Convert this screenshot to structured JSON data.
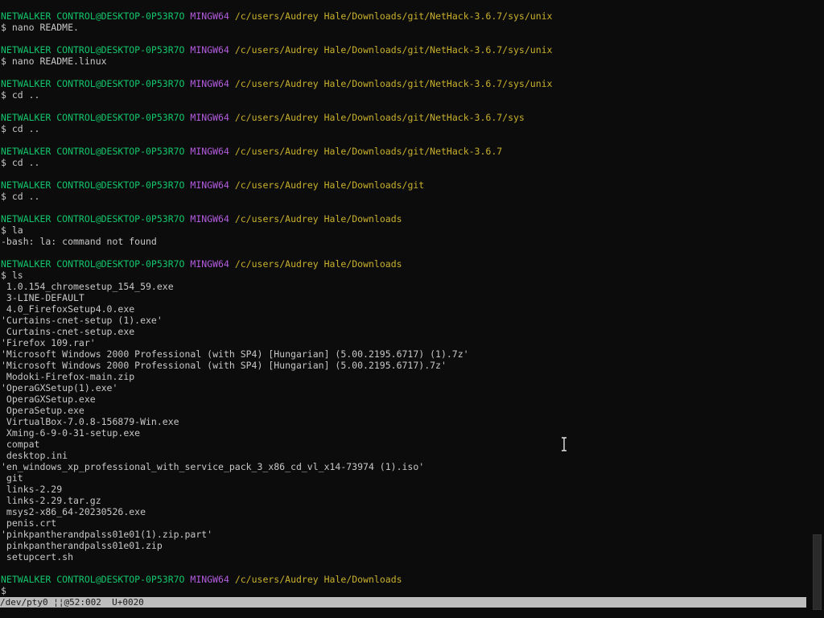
{
  "terminal": {
    "prompt_user": "NETWALKER CONTROL@DESKTOP-0P53R7O",
    "prompt_system": "MINGW64",
    "blocks": [
      {
        "path": "/c/users/Audrey Hale/Downloads/git/NetHack-3.6.7/sys/unix",
        "lines": [
          "$ nano README."
        ]
      },
      {
        "path": "/c/users/Audrey Hale/Downloads/git/NetHack-3.6.7/sys/unix",
        "lines": [
          "$ nano README.linux"
        ]
      },
      {
        "path": "/c/users/Audrey Hale/Downloads/git/NetHack-3.6.7/sys/unix",
        "lines": [
          "$ cd .."
        ]
      },
      {
        "path": "/c/users/Audrey Hale/Downloads/git/NetHack-3.6.7/sys",
        "lines": [
          "$ cd .."
        ]
      },
      {
        "path": "/c/users/Audrey Hale/Downloads/git/NetHack-3.6.7",
        "lines": [
          "$ cd .."
        ]
      },
      {
        "path": "/c/users/Audrey Hale/Downloads/git",
        "lines": [
          "$ cd .."
        ]
      },
      {
        "path": "/c/users/Audrey Hale/Downloads",
        "lines": [
          "$ la",
          "-bash: la: command not found"
        ]
      },
      {
        "path": "/c/users/Audrey Hale/Downloads",
        "lines": [
          "$ ls",
          " 1.0.154_chromesetup_154_59.exe",
          " 3-LINE-DEFAULT",
          " 4.0_FirefoxSetup4.0.exe",
          "'Curtains-cnet-setup (1).exe'",
          " Curtains-cnet-setup.exe",
          "'Firefox 109.rar'",
          "'Microsoft Windows 2000 Professional (with SP4) [Hungarian] (5.00.2195.6717) (1).7z'",
          "'Microsoft Windows 2000 Professional (with SP4) [Hungarian] (5.00.2195.6717).7z'",
          " Modoki-Firefox-main.zip",
          "'OperaGXSetup(1).exe'",
          " OperaGXSetup.exe",
          " OperaSetup.exe",
          " VirtualBox-7.0.8-156879-Win.exe",
          " Xming-6-9-0-31-setup.exe",
          " compat",
          " desktop.ini",
          "'en_windows_xp_professional_with_service_pack_3_x86_cd_vl_x14-73974 (1).iso'",
          " git",
          " links-2.29",
          " links-2.29.tar.gz",
          " msys2-x86_64-20230526.exe",
          " penis.crt",
          "'pinkpantherandpalss01e01(1).zip.part'",
          " pinkpantherandpalss01e01.zip",
          " setupcert.sh"
        ]
      },
      {
        "path": "/c/users/Audrey Hale/Downloads",
        "lines": [
          "$"
        ]
      }
    ]
  },
  "statusbar": {
    "text": "/dev/pty0 ¦¦@52:002  U+0020"
  },
  "colors": {
    "background": "#0c0c0c",
    "text": "#c8c8c8",
    "user": "#13c66b",
    "system": "#b45ce0",
    "path": "#c9b12d"
  },
  "icons": {
    "mouse_cursor": "text-ibeam-cursor-icon"
  }
}
